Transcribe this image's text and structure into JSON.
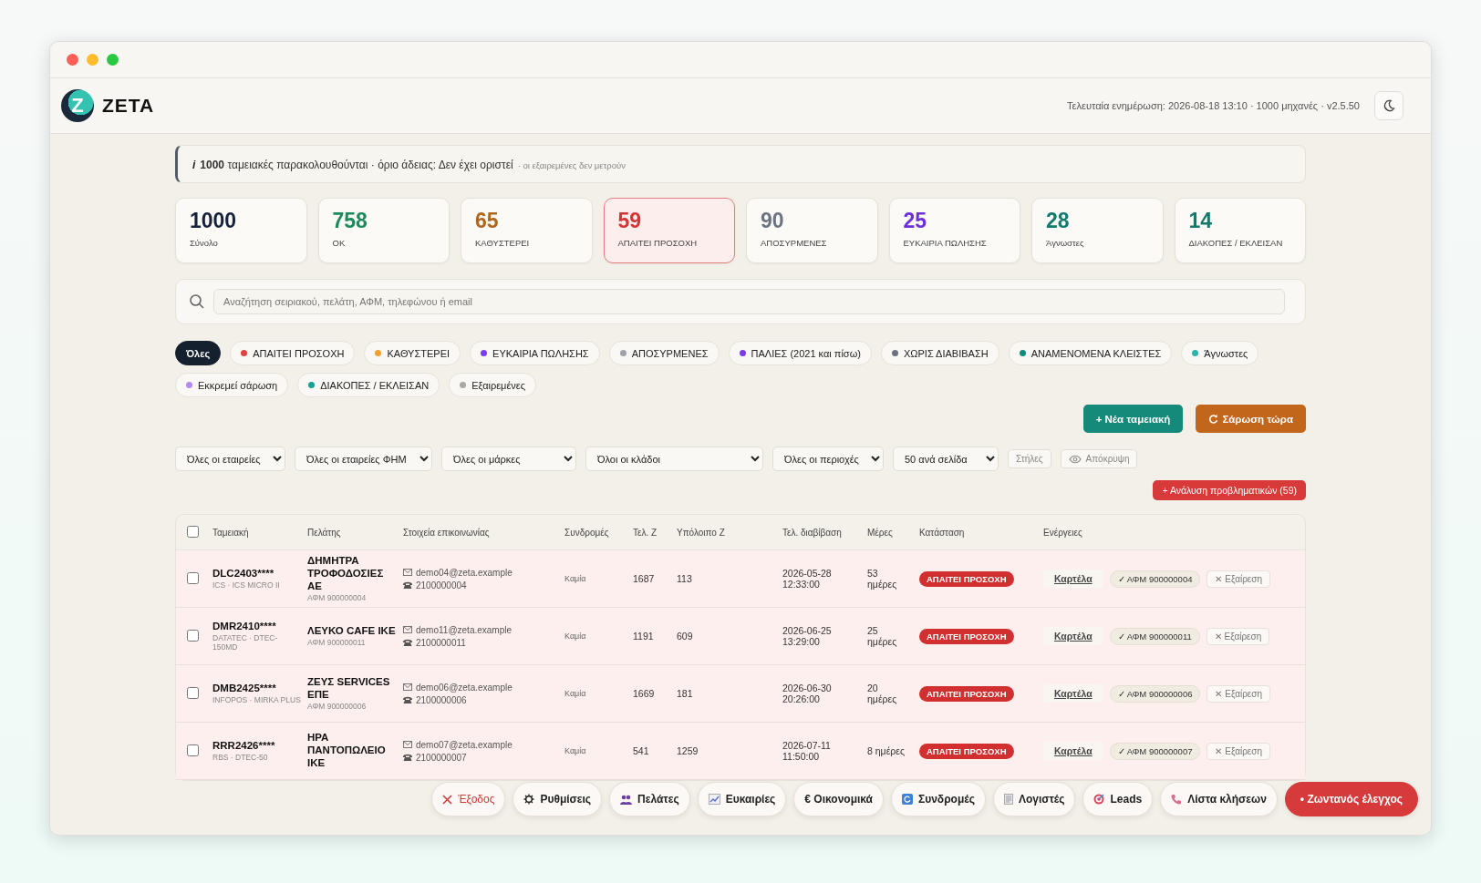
{
  "header": {
    "logo_mark": "Z",
    "logo_text": "ZETA",
    "status": "Τελευταία ενημέρωση: 2026-08-18 13:10 · 1000 μηχανές · v2.5.50"
  },
  "info": {
    "mark": "i",
    "text": "**1000** ταμειακές παρακολουθούνται · όριο άδειας: Δεν έχει οριστεί",
    "note": "· οι εξαιρεμένες δεν μετρούν"
  },
  "stats": [
    {
      "value": "1000",
      "label": "Σύνολο",
      "color": "#17233a",
      "selected": false
    },
    {
      "value": "758",
      "label": "ΟΚ",
      "color": "#1c8a5a",
      "selected": false
    },
    {
      "value": "65",
      "label": "ΚΑΘΥΣΤΕΡΕΙ",
      "color": "#b0661c",
      "selected": false
    },
    {
      "value": "59",
      "label": "ΑΠΑΙΤΕΙ ΠΡΟΣΟΧΗ",
      "color": "#d23636",
      "selected": true
    },
    {
      "value": "90",
      "label": "ΑΠΟΣΥΡΜΕΝΕΣ",
      "color": "#6b7280",
      "selected": false
    },
    {
      "value": "25",
      "label": "ΕΥΚΑΙΡΙΑ ΠΩΛΗΣΗΣ",
      "color": "#6d2fd6",
      "selected": false
    },
    {
      "value": "28",
      "label": "Άγνωστες",
      "color": "#137a6e",
      "selected": false
    },
    {
      "value": "14",
      "label": "ΔΙΑΚΟΠΕΣ / ΕΚΛΕΙΣΑΝ",
      "color": "#137a6e",
      "selected": false
    }
  ],
  "search": {
    "placeholder": "Αναζήτηση σειριακού, πελάτη, ΑΦΜ, τηλεφώνου ή email"
  },
  "chips": [
    {
      "label": "Όλες",
      "selected": true
    },
    {
      "label": "ΑΠΑΙΤΕΙ ΠΡΟΣΟΧΗ",
      "color": "#e0403f",
      "selected": false
    },
    {
      "label": "ΚΑΘΥΣΤΕΡΕΙ",
      "color": "#f0a030",
      "selected": false
    },
    {
      "label": "ΕΥΚΑΙΡΙΑ ΠΩΛΗΣΗΣ",
      "color": "#7c3aed",
      "selected": false
    },
    {
      "label": "ΑΠΟΣΥΡΜΕΝΕΣ",
      "color": "#a0a3a8",
      "selected": false
    },
    {
      "label": "ΠΑΛΙΕΣ (2021 και πίσω)",
      "color": "#7c3aed",
      "selected": false
    },
    {
      "label": "ΧΩΡΙΣ ΔΙΑΒΙΒΑΣΗ",
      "color": "#6b7280",
      "selected": false
    },
    {
      "label": "ΑΝΑΜΕΝΟΜΕΝΑ ΚΛΕΙΣΤΕΣ",
      "color": "#0f8a7e",
      "selected": false
    },
    {
      "label": "Άγνωστες",
      "color": "#2bb5a8",
      "selected": false
    },
    {
      "label": "Εκκρεμεί σάρωση",
      "color": "#b38af0",
      "selected": false
    },
    {
      "label": "ΔΙΑΚΟΠΕΣ / ΕΚΛΕΙΣΑΝ",
      "color": "#14a394",
      "selected": false
    },
    {
      "label": "Εξαιρεμένες",
      "color": "#a8a8a8",
      "selected": false
    }
  ],
  "actions": {
    "new": "+ Νέα ταμειακή",
    "scan": "Σάρωση τώρα"
  },
  "filters": [
    "Όλες οι εταιρείες",
    "Όλες οι εταιρείες ΦΗΜ",
    "Όλες οι μάρκες",
    "Όλοι οι κλάδοι",
    "Όλες οι περιοχές",
    "50 ανά σελίδα"
  ],
  "columns_button": "Στήλες",
  "hide_button": "Απόκρυψη",
  "analysis_button": "+ Ανάλυση προβληματικών (59)",
  "table": {
    "columns": [
      "Ταμειακή",
      "Πελάτης",
      "Στοιχεία επικοινωνίας",
      "Συνδρομές",
      "Τελ. Ζ",
      "Υπόλοιπο Ζ",
      "Τελ. διαβίβαση",
      "Μέρες",
      "Κατάσταση",
      "Ενέργειες"
    ],
    "header_checked": false,
    "rows": [
      {
        "checked": false,
        "serial": "DLC2403****",
        "model": "ICS · ICS MICRO II",
        "client": "ΔΗΜΗΤΡΑ ΤΡΟΦΟΔΟΣΙΕΣ ΑΕ",
        "afm": "ΑΦΜ 900000004",
        "email": "demo04@zeta.example",
        "phone": "2100000004",
        "subscriptions": "Καμία",
        "last_z": "1687",
        "balance_z": "113",
        "last_sent": "2026-05-28 12:33:00",
        "days": "53 ημέρες",
        "status": "ΑΠΑΙΤΕΙ ΠΡΟΣΟΧΗ",
        "card": "Καρτέλα",
        "afm_badge": "✓ ΑΦΜ 900000004",
        "exclude": "✕ Εξαίρεση"
      },
      {
        "checked": false,
        "serial": "DMR2410****",
        "model": "DATATEC · DTEC-150MD",
        "client": "ΛΕΥΚΟ CAFE ΙΚΕ",
        "afm": "ΑΦΜ 900000011",
        "email": "demo11@zeta.example",
        "phone": "2100000011",
        "subscriptions": "Καμία",
        "last_z": "1191",
        "balance_z": "609",
        "last_sent": "2026-06-25 13:29:00",
        "days": "25 ημέρες",
        "status": "ΑΠΑΙΤΕΙ ΠΡΟΣΟΧΗ",
        "card": "Καρτέλα",
        "afm_badge": "✓ ΑΦΜ 900000011",
        "exclude": "✕ Εξαίρεση"
      },
      {
        "checked": false,
        "serial": "DMB2425****",
        "model": "INFOPOS · MIRKA PLUS",
        "client": "ΖΕΥΣ SERVICES ΕΠΕ",
        "afm": "ΑΦΜ 900000006",
        "email": "demo06@zeta.example",
        "phone": "2100000006",
        "subscriptions": "Καμία",
        "last_z": "1669",
        "balance_z": "181",
        "last_sent": "2026-06-30 20:26:00",
        "days": "20 ημέρες",
        "status": "ΑΠΑΙΤΕΙ ΠΡΟΣΟΧΗ",
        "card": "Καρτέλα",
        "afm_badge": "✓ ΑΦΜ 900000006",
        "exclude": "✕ Εξαίρεση"
      },
      {
        "checked": false,
        "serial": "RRR2426****",
        "model": "RBS · DTEC-50",
        "client": "ΗΡΑ ΠΑΝΤΟΠΩΛΕΙΟ ΙΚΕ",
        "email": "demo07@zeta.example",
        "phone": "2100000007",
        "subscriptions": "Καμία",
        "last_z": "541",
        "balance_z": "1259",
        "last_sent": "2026-07-11 11:50:00",
        "days": "8 ημέρες",
        "status": "ΑΠΑΙΤΕΙ ΠΡΟΣΟΧΗ",
        "card": "Καρτέλα",
        "afm_badge": "✓ ΑΦΜ 900000007",
        "exclude": "✕ Εξαίρεση"
      }
    ]
  },
  "dock": [
    {
      "kind": "exit",
      "label": "Έξοδος"
    },
    {
      "kind": "gear",
      "label": "Ρυθμίσεις"
    },
    {
      "kind": "people",
      "label": "Πελάτες"
    },
    {
      "kind": "chart",
      "label": "Ευκαιρίες"
    },
    {
      "kind": "plain",
      "label": "€ Οικονομικά"
    },
    {
      "kind": "subscriptions",
      "label": "Συνδρομές"
    },
    {
      "kind": "document",
      "label": "Λογιστές"
    },
    {
      "kind": "target",
      "label": "Leads"
    },
    {
      "kind": "phone",
      "label": "Λίστα κλήσεων"
    },
    {
      "kind": "live",
      "label": "• Ζωντανός έλεγχος"
    }
  ]
}
